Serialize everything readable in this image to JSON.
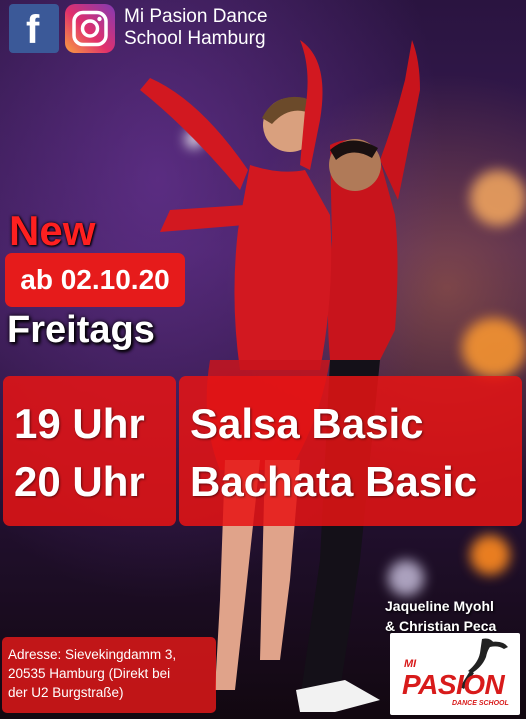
{
  "header": {
    "facebook_icon": "facebook-icon",
    "instagram_icon": "instagram-icon",
    "school_line1": "Mi Pasion Dance",
    "school_line2": "School Hamburg"
  },
  "promo": {
    "new_label": "New",
    "start_date": "ab 02.10.20",
    "day": "Freitags"
  },
  "schedule": [
    {
      "time": "19 Uhr",
      "course": "Salsa Basic"
    },
    {
      "time": "20 Uhr",
      "course": "Bachata Basic"
    }
  ],
  "dancers": {
    "line1": "Jaqueline Myohl",
    "line2": "& Christian Peca"
  },
  "address": {
    "line1": "Adresse: Sievekingdamm 3,",
    "line2": "20535 Hamburg (Direkt bei",
    "line3": "der U2 Burgstraße)"
  },
  "logo": {
    "mi": "MI",
    "pasion": "PASION",
    "sub": "DANCE SCHOOL"
  },
  "colors": {
    "accent_red": "#e61b1b",
    "facebook_blue": "#3b5998",
    "background_purple": "#3a1c55"
  }
}
